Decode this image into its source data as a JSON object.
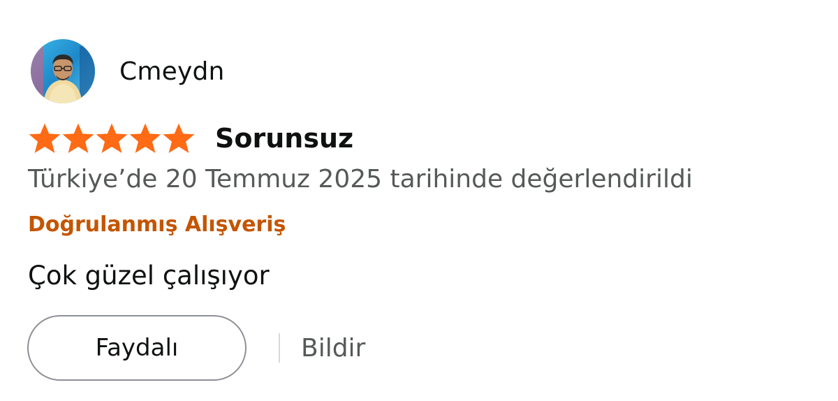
{
  "review": {
    "profile_name": "Cmeydn",
    "rating": 5,
    "rating_max": 5,
    "title": "Sorunsuz",
    "date_text": "Türkiye’de 20 Temmuz 2025 tarihinde değerlendirildi",
    "verified_label": "Doğrulanmış Alışveriş",
    "body": "Çok güzel çalışıyor"
  },
  "actions": {
    "helpful_label": "Faydalı",
    "report_label": "Bildir"
  },
  "icons": {
    "star": "star-icon",
    "avatar": "avatar-photo"
  },
  "colors": {
    "star": "#ff6a14",
    "verified": "#c45500",
    "secondary_text": "#565959",
    "primary_text": "#0f1111",
    "button_border": "#8d9096"
  }
}
